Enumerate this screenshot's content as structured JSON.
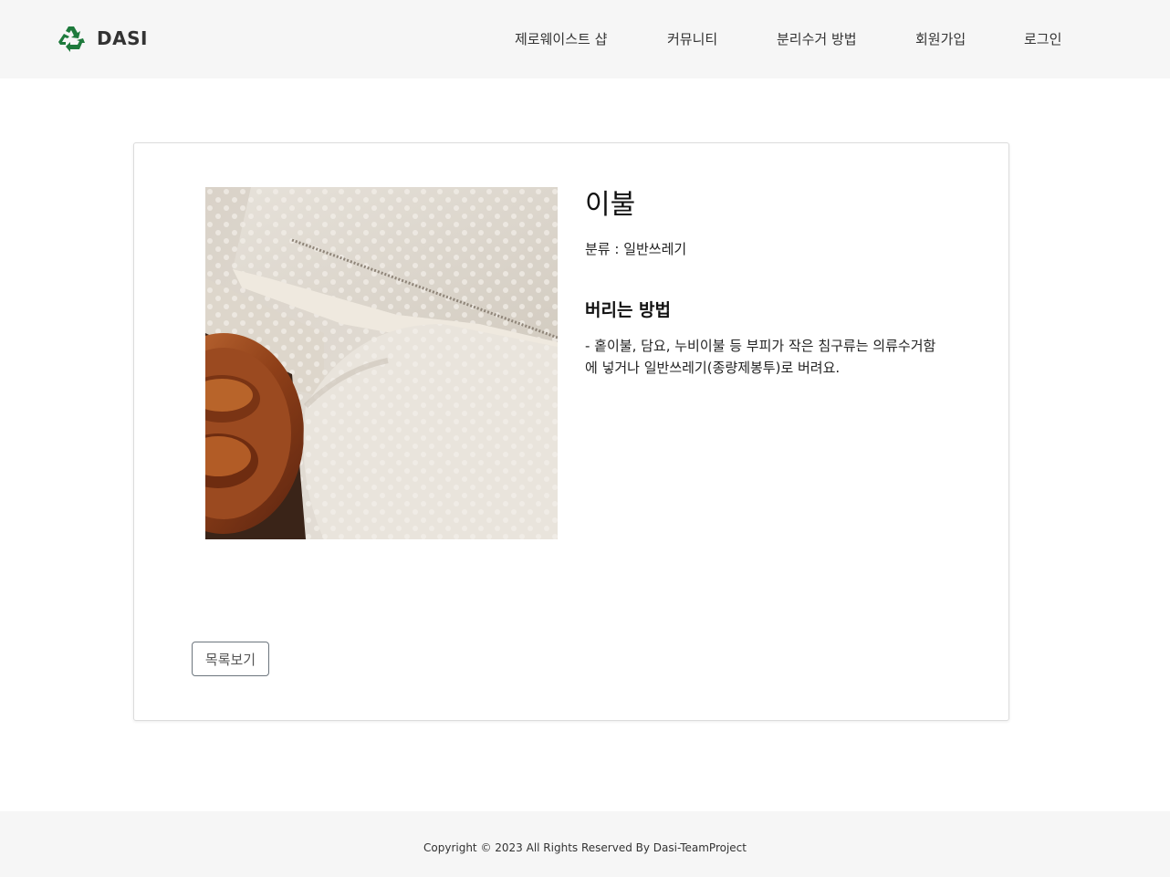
{
  "header": {
    "brand": "DASI",
    "logo_icon": "recycle-icon",
    "nav": {
      "shop": "제로웨이스트 샵",
      "community": "커뮤니티",
      "method": "분리수거 방법",
      "signup": "회원가입",
      "login": "로그인"
    }
  },
  "item": {
    "title": "이불",
    "category": "분류 : 일반쓰레기",
    "section_title": "버리는 방법",
    "method": "- 홑이불, 담요, 누비이불 등 부피가 작은 침구류는 의류수거함에 넣거나 일반쓰레기(종량제봉투)로 버려요.",
    "image_alt": "이불"
  },
  "actions": {
    "list_button": "목록보기"
  },
  "footer": {
    "copyright": "Copyright © 2023 All Rights Reserved By Dasi-TeamProject"
  },
  "colors": {
    "header_bg": "#f6f6f6",
    "logo_green": "#1e7a3c",
    "card_border": "#dcdcdc"
  }
}
